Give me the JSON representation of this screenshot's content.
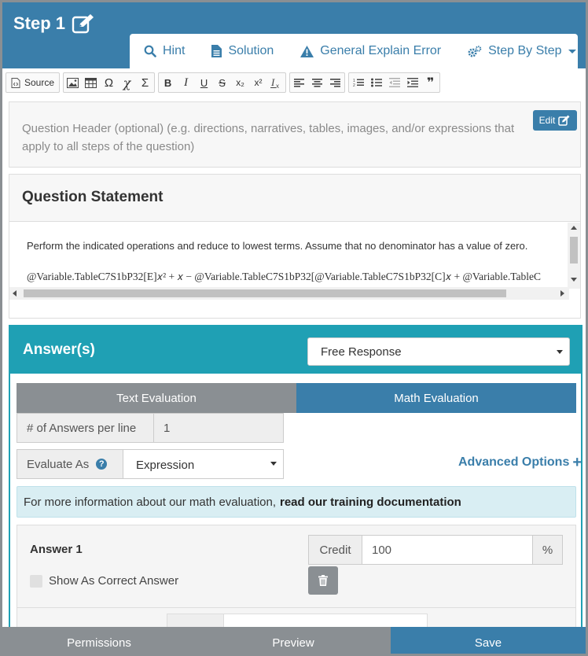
{
  "step": {
    "title": "Step 1"
  },
  "tabs": [
    {
      "label": "Hint",
      "icon": "search-icon"
    },
    {
      "label": "Solution",
      "icon": "document-icon"
    },
    {
      "label": "General Explain Error",
      "icon": "warning-icon"
    },
    {
      "label": "Step By Step",
      "icon": "gears-icon"
    }
  ],
  "toolbar": {
    "source_label": "Source",
    "omega": "Ω",
    "chi": "𝜒",
    "sigma": "Σ",
    "bold": "B",
    "italic": "I",
    "underline": "U",
    "strike": "S",
    "subscript": "x₂",
    "superscript": "x²",
    "remove_format": "Ix",
    "quote": "❞"
  },
  "question_header": {
    "placeholder": "Question Header (optional) (e.g. directions, narratives, tables, images, and/or expressions that apply to all steps of the question)",
    "line1": "Question Header (optional) (e.g. directions, narratives, tables, images, and/or expressions that",
    "line2": "apply to all steps of the question)",
    "edit_label": "Edit"
  },
  "question_statement": {
    "title": "Question Statement",
    "line1": "Perform the indicated operations and reduce to lowest terms. Assume that no denominator has a value of zero.",
    "line2": "@Variable.TableC7S1bP32[E]𝑥² + 𝑥 − @Variable.TableC7S1bP32[@Variable.TableC7S1bP32[C]𝑥 + @Variable.TableC"
  },
  "answers": {
    "title": "Answer(s)",
    "response_type": "Free Response",
    "tab_text": "Text Evaluation",
    "tab_math": "Math Evaluation",
    "per_line_label": "# of Answers per line",
    "per_line_value": "1",
    "evaluate_as_label": "Evaluate As",
    "evaluate_as_value": "Expression",
    "help_glyph": "?",
    "advanced_label": "Advanced Options",
    "advanced_plus": "+",
    "info_text": "For more information about our math evaluation,",
    "info_link": "read our training documentation",
    "answer1": {
      "title": "Answer 1",
      "credit_label": "Credit",
      "credit_value": "100",
      "percent": "%",
      "show_correct_label": "Show As Correct Answer"
    }
  },
  "bottom": {
    "permissions": "Permissions",
    "preview": "Preview",
    "save": "Save"
  },
  "colors": {
    "primary": "#3a7eaa",
    "teal": "#1fa0b4",
    "gray": "#8a8f93",
    "info_bg": "#d9eef3"
  }
}
